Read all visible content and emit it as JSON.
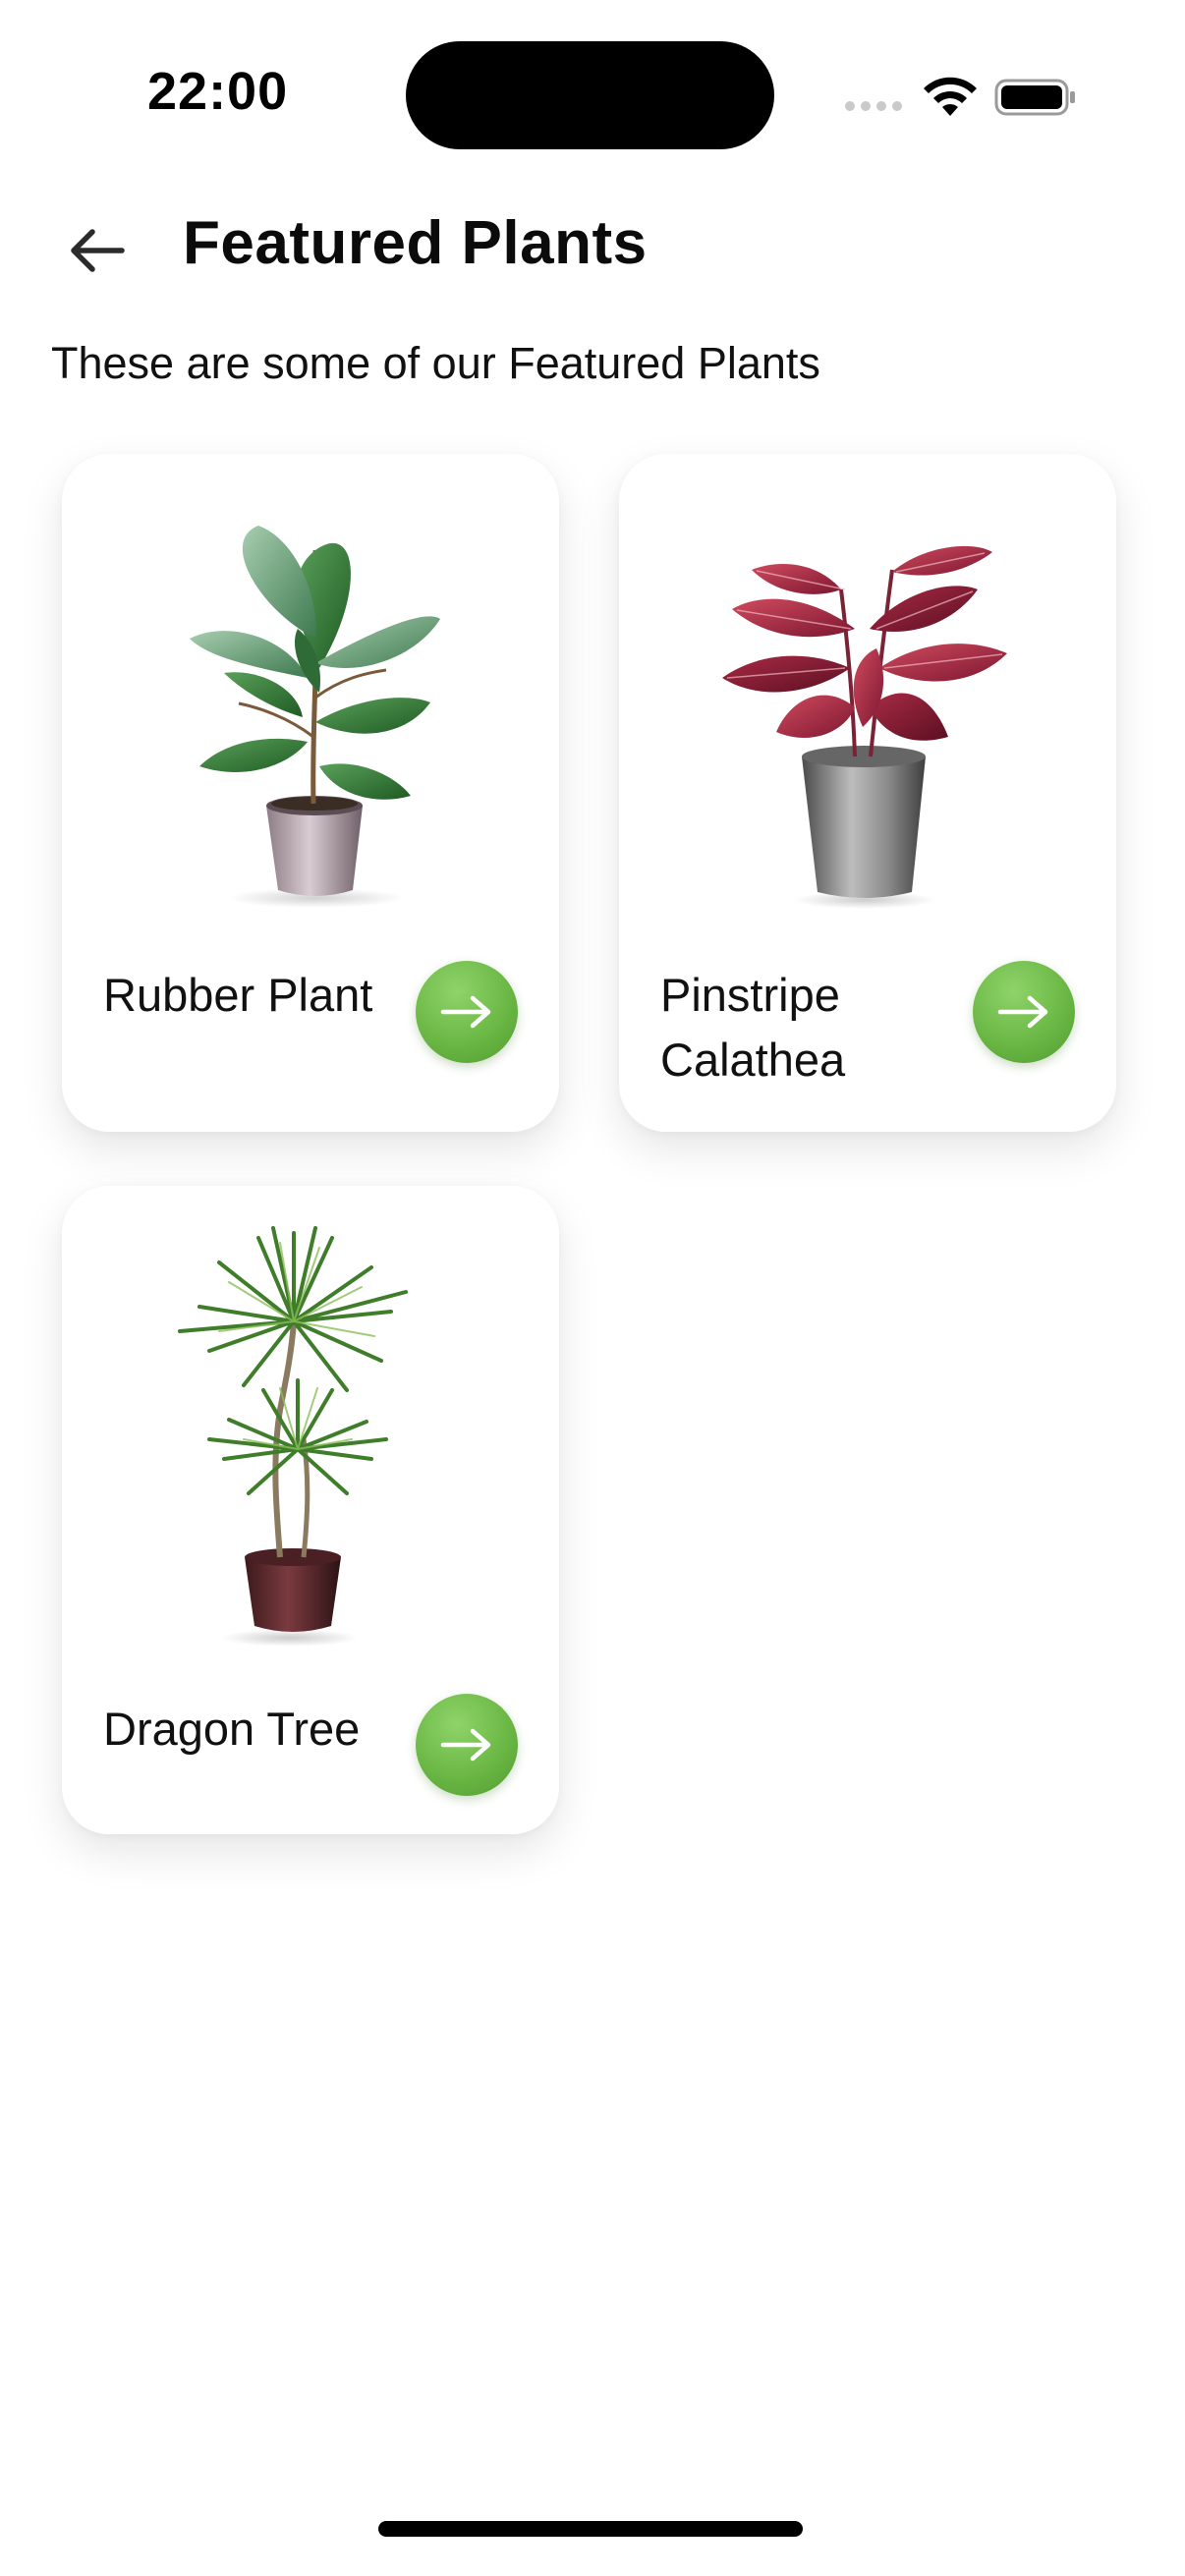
{
  "status_bar": {
    "time": "22:00",
    "icons": [
      "signal-icon",
      "wifi-icon",
      "battery-icon"
    ]
  },
  "header": {
    "back_icon": "arrow-left-icon",
    "title": "Featured Plants"
  },
  "subtitle": "These are some of our Featured Plants",
  "plants": [
    {
      "name": "Rubber Plant",
      "image": "rubber-plant-image",
      "action_icon": "arrow-right-icon"
    },
    {
      "name": "Pinstripe Calathea",
      "image": "pinstripe-calathea-image",
      "action_icon": "arrow-right-icon"
    },
    {
      "name": "Dragon Tree",
      "image": "dragon-tree-image",
      "action_icon": "arrow-right-icon"
    }
  ],
  "colors": {
    "accent_green": "#6bb845",
    "background": "#ffffff",
    "text": "#111111"
  }
}
